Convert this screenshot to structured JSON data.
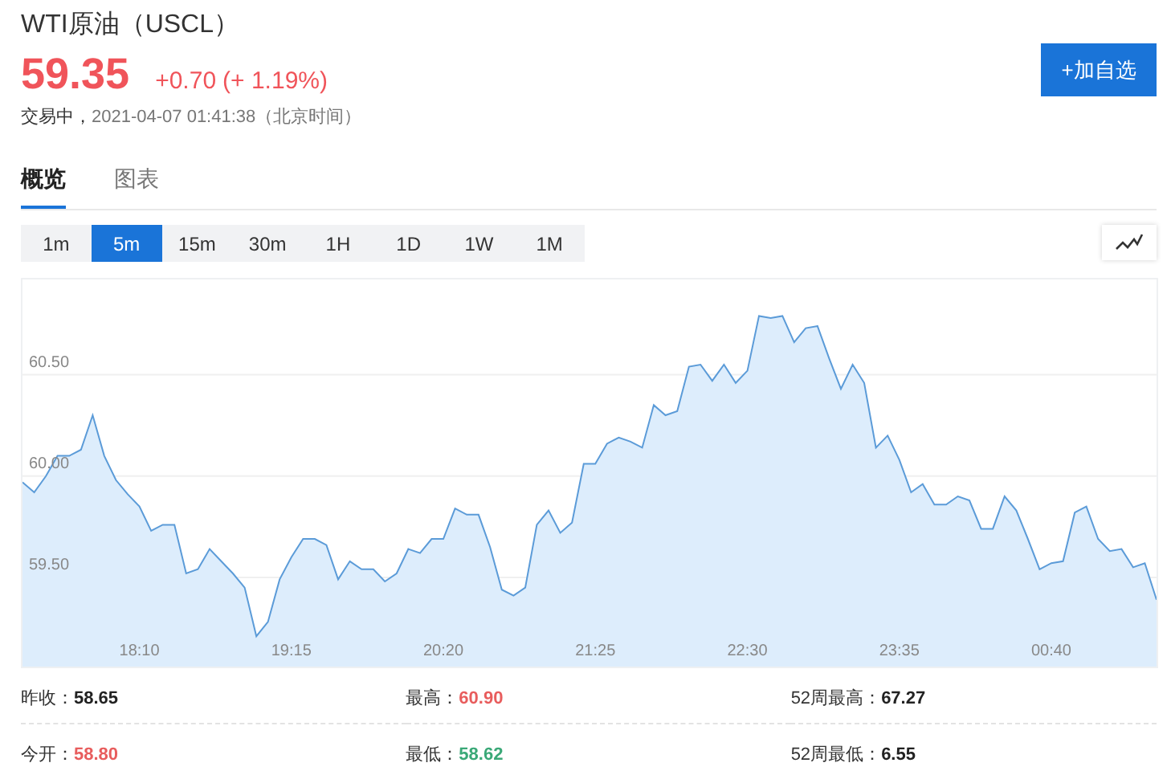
{
  "header": {
    "title": "WTI原油（USCL）",
    "price": "59.35",
    "change": "+0.70",
    "change_percent": "(+ 1.19%)",
    "status": "交易中，",
    "timestamp": "2021-04-07 01:41:38（北京时间）",
    "watchlist_button": "+加自选"
  },
  "tabs": [
    {
      "label": "概览",
      "selected": true
    },
    {
      "label": "图表",
      "selected": false
    }
  ],
  "intervals": [
    {
      "label": "1m",
      "selected": false
    },
    {
      "label": "5m",
      "selected": true
    },
    {
      "label": "15m",
      "selected": false
    },
    {
      "label": "30m",
      "selected": false
    },
    {
      "label": "1H",
      "selected": false
    },
    {
      "label": "1D",
      "selected": false
    },
    {
      "label": "1W",
      "selected": false
    },
    {
      "label": "1M",
      "selected": false
    }
  ],
  "chart": {
    "chart_data": {
      "type": "area",
      "grid": true,
      "ylim": [
        59.06,
        60.97
      ],
      "categories": [
        null,
        null,
        null,
        null,
        null,
        null,
        null,
        null,
        null,
        null,
        "18:10",
        null,
        null,
        null,
        null,
        null,
        null,
        null,
        null,
        null,
        null,
        null,
        null,
        "19:15",
        null,
        null,
        null,
        null,
        null,
        null,
        null,
        null,
        null,
        null,
        null,
        null,
        "20:20",
        null,
        null,
        null,
        null,
        null,
        null,
        null,
        null,
        null,
        null,
        null,
        null,
        "21:25",
        null,
        null,
        null,
        null,
        null,
        null,
        null,
        null,
        null,
        null,
        null,
        null,
        "22:30",
        null,
        null,
        null,
        null,
        null,
        null,
        null,
        null,
        null,
        null,
        null,
        null,
        "23:35",
        null,
        null,
        null,
        null,
        null,
        null,
        null,
        null,
        null,
        null,
        null,
        null,
        "00:40",
        null,
        null,
        null,
        null,
        null,
        null,
        null,
        null,
        null
      ],
      "yticks": [
        {
          "value": 59.5,
          "label": "59.50"
        },
        {
          "value": 60,
          "label": "60.00"
        },
        {
          "value": 60.5,
          "label": "60.50"
        }
      ],
      "series": [
        {
          "color": "#5b9bd8",
          "values": [
            59.97,
            59.92,
            60.0,
            60.1,
            60.1,
            60.13,
            60.3,
            60.1,
            59.98,
            59.91,
            59.85,
            59.73,
            59.76,
            59.76,
            59.52,
            59.54,
            59.64,
            59.58,
            59.52,
            59.45,
            59.21,
            59.28,
            59.49,
            59.6,
            59.69,
            59.69,
            59.66,
            59.49,
            59.58,
            59.54,
            59.54,
            59.48,
            59.52,
            59.64,
            59.62,
            59.69,
            59.69,
            59.84,
            59.81,
            59.81,
            59.65,
            59.44,
            59.41,
            59.45,
            59.76,
            59.83,
            59.72,
            59.77,
            60.06,
            60.06,
            60.16,
            60.19,
            60.17,
            60.14,
            60.35,
            60.3,
            60.32,
            60.54,
            60.55,
            60.47,
            60.55,
            60.46,
            60.52,
            60.79,
            60.78,
            60.79,
            60.66,
            60.73,
            60.74,
            60.58,
            60.43,
            60.55,
            60.46,
            60.14,
            60.2,
            60.08,
            59.92,
            59.96,
            59.86,
            59.86,
            59.9,
            59.88,
            59.74,
            59.74,
            59.9,
            59.83,
            59.69,
            59.54,
            59.57,
            59.58,
            59.82,
            59.85,
            59.69,
            59.63,
            59.64,
            59.55,
            59.57,
            59.39
          ]
        }
      ]
    }
  },
  "stats": [
    {
      "label": "昨收：",
      "value": "58.65",
      "color": "#222222"
    },
    {
      "label": "最高：",
      "value": "60.90",
      "color": "#e85d5d"
    },
    {
      "label": "52周最高：",
      "value": "67.27",
      "color": "#222222"
    },
    {
      "label": "今开：",
      "value": "58.80",
      "color": "#e85d5d"
    },
    {
      "label": "最低：",
      "value": "58.62",
      "color": "#3aa877"
    },
    {
      "label": "52周最低：",
      "value": "6.55",
      "color": "#222222"
    }
  ]
}
